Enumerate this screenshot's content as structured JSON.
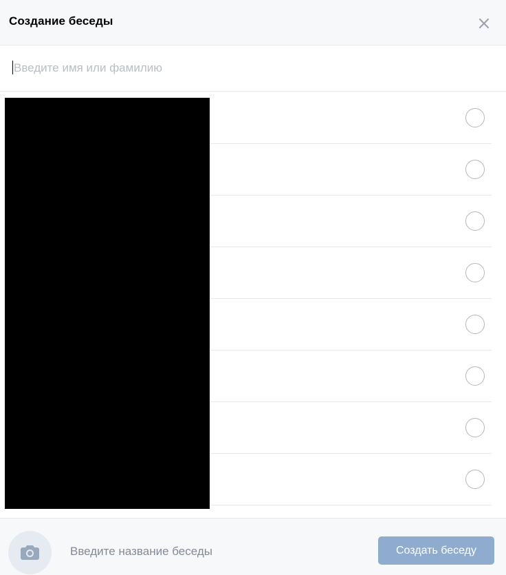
{
  "header": {
    "title": "Создание беседы",
    "close_icon": "close-icon"
  },
  "search": {
    "placeholder": "Введите имя или фамилию",
    "value": ""
  },
  "contacts": {
    "items": [
      {
        "name": "",
        "selected": false
      },
      {
        "name": "",
        "selected": false
      },
      {
        "name": "",
        "selected": false
      },
      {
        "name": "",
        "selected": false
      },
      {
        "name": "",
        "selected": false
      },
      {
        "name": "",
        "selected": false
      },
      {
        "name": "",
        "selected": false
      },
      {
        "name": "",
        "selected": false
      }
    ]
  },
  "footer": {
    "photo_icon": "camera-icon",
    "chat_name_placeholder": "Введите название беседы",
    "chat_name_value": "",
    "create_button_label": "Создать беседу"
  },
  "colors": {
    "accent_disabled": "#8faccf",
    "header_bg": "#f7f8fa",
    "separator": "#e7e8ec",
    "checkbox_border": "#b2b7bf",
    "icon_gray": "#99a2ad"
  }
}
